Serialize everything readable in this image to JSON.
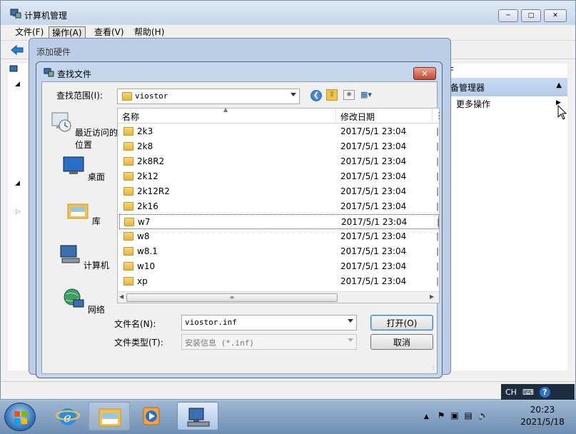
{
  "mmc": {
    "title": "计算机管理",
    "menu": [
      "文件(F)",
      "操作(A)",
      "查看(V)",
      "帮助(H)"
    ],
    "right_header_partial": "F",
    "right_section": "备管理器",
    "more_actions": "更多操作"
  },
  "wizard": {
    "title": "添加硬件"
  },
  "dialog": {
    "title": "查找文件",
    "lookin_label": "查找范围(I):",
    "lookin_value": "viostor",
    "places": [
      "最近访问的位置",
      "桌面",
      "库",
      "计算机",
      "网络"
    ],
    "columns": [
      "名称",
      "修改日期"
    ],
    "files": [
      {
        "name": "2k3",
        "date": "2017/5/1 23:04"
      },
      {
        "name": "2k8",
        "date": "2017/5/1 23:04"
      },
      {
        "name": "2k8R2",
        "date": "2017/5/1 23:04"
      },
      {
        "name": "2k12",
        "date": "2017/5/1 23:04"
      },
      {
        "name": "2k12R2",
        "date": "2017/5/1 23:04"
      },
      {
        "name": "2k16",
        "date": "2017/5/1 23:04"
      },
      {
        "name": "w7",
        "date": "2017/5/1 23:04"
      },
      {
        "name": "w8",
        "date": "2017/5/1 23:04"
      },
      {
        "name": "w8.1",
        "date": "2017/5/1 23:04"
      },
      {
        "name": "w10",
        "date": "2017/5/1 23:04"
      },
      {
        "name": "xp",
        "date": "2017/5/1 23:04"
      }
    ],
    "selected_file": "w7",
    "filename_label": "文件名(N):",
    "filename_value": "viostor.inf",
    "filetype_label": "文件类型(T):",
    "filetype_value": "安装信息 (*.inf)",
    "open_button": "打开(O)",
    "cancel_button": "取消"
  },
  "language_bar": {
    "lang": "CH"
  },
  "taskbar": {
    "time": "20:23",
    "date": "2021/5/18"
  }
}
